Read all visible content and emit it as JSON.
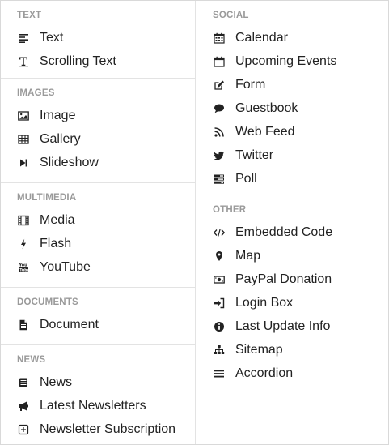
{
  "left": {
    "sections": [
      {
        "title": "TEXT",
        "items": [
          {
            "label": "Text",
            "icon": "text-align-icon"
          },
          {
            "label": "Scrolling Text",
            "icon": "text-cursor-icon"
          }
        ]
      },
      {
        "title": "IMAGES",
        "items": [
          {
            "label": "Image",
            "icon": "image-icon"
          },
          {
            "label": "Gallery",
            "icon": "grid-icon"
          },
          {
            "label": "Slideshow",
            "icon": "step-forward-icon"
          }
        ]
      },
      {
        "title": "MULTIMEDIA",
        "items": [
          {
            "label": "Media",
            "icon": "film-icon"
          },
          {
            "label": "Flash",
            "icon": "bolt-icon"
          },
          {
            "label": "YouTube",
            "icon": "youtube-icon"
          }
        ]
      },
      {
        "title": "DOCUMENTS",
        "items": [
          {
            "label": "Document",
            "icon": "document-icon"
          }
        ]
      },
      {
        "title": "NEWS",
        "items": [
          {
            "label": "News",
            "icon": "news-icon"
          },
          {
            "label": "Latest Newsletters",
            "icon": "bullhorn-icon"
          },
          {
            "label": "Newsletter Subscription",
            "icon": "plus-square-icon"
          }
        ]
      }
    ]
  },
  "right": {
    "sections": [
      {
        "title": "SOCIAL",
        "items": [
          {
            "label": "Calendar",
            "icon": "calendar-icon"
          },
          {
            "label": "Upcoming Events",
            "icon": "calendar-empty-icon"
          },
          {
            "label": "Form",
            "icon": "edit-icon"
          },
          {
            "label": "Guestbook",
            "icon": "comment-icon"
          },
          {
            "label": "Web Feed",
            "icon": "rss-icon"
          },
          {
            "label": "Twitter",
            "icon": "twitter-icon"
          },
          {
            "label": "Poll",
            "icon": "poll-icon"
          }
        ]
      },
      {
        "title": "OTHER",
        "items": [
          {
            "label": "Embedded Code",
            "icon": "code-icon"
          },
          {
            "label": "Map",
            "icon": "map-marker-icon"
          },
          {
            "label": "PayPal Donation",
            "icon": "money-icon"
          },
          {
            "label": "Login Box",
            "icon": "sign-in-icon"
          },
          {
            "label": "Last Update Info",
            "icon": "info-circle-icon"
          },
          {
            "label": "Sitemap",
            "icon": "sitemap-icon"
          },
          {
            "label": "Accordion",
            "icon": "bars-icon"
          }
        ]
      }
    ]
  }
}
